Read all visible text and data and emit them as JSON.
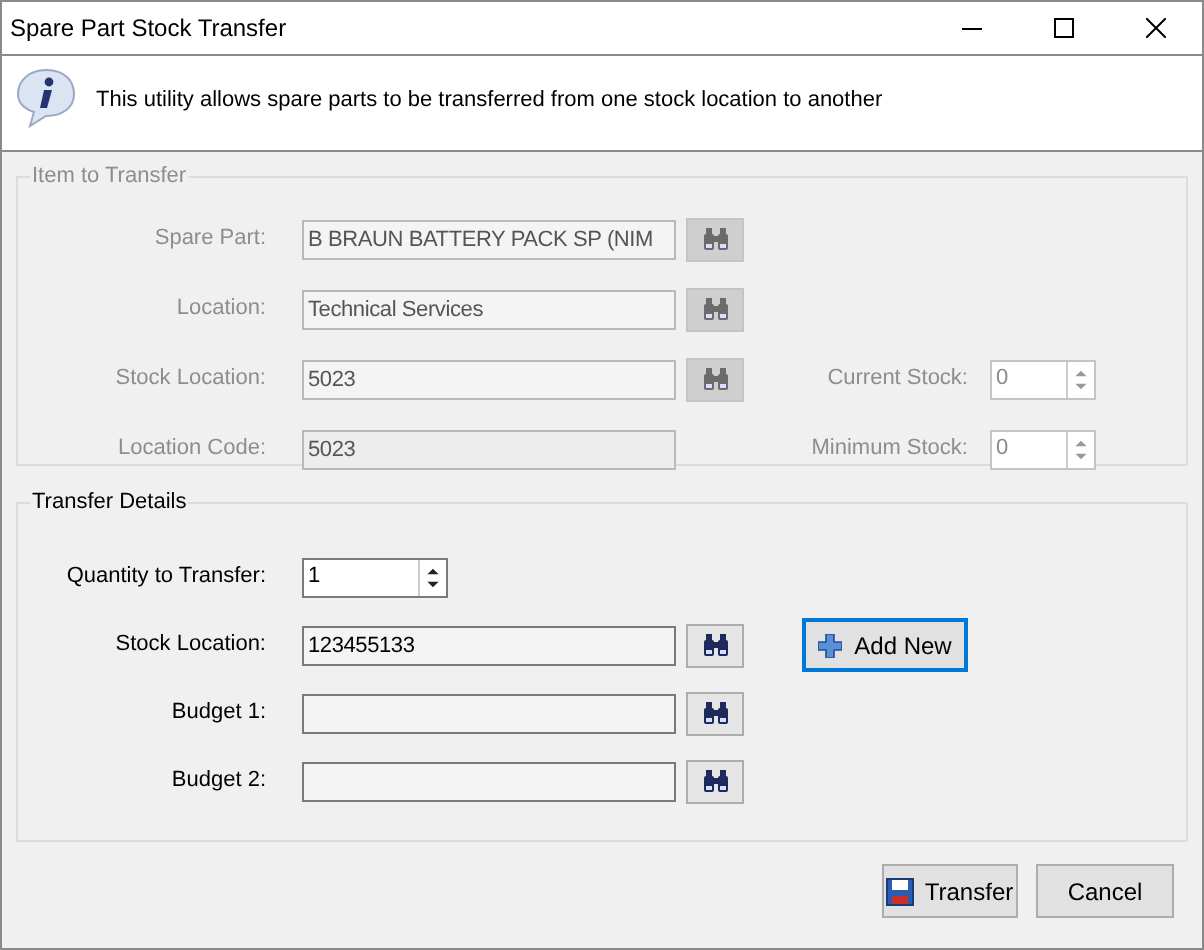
{
  "window": {
    "title": "Spare Part Stock Transfer"
  },
  "info": {
    "text": "This utility allows spare parts to be transferred from one stock location to another"
  },
  "item_group": {
    "title": "Item to Transfer",
    "disabled": true,
    "rows": [
      {
        "label": "Spare Part:",
        "value": "B BRAUN BATTERY PACK SP (NIM",
        "lookup": true
      },
      {
        "label": "Location:",
        "value": "Technical Services",
        "lookup": true
      },
      {
        "label": "Stock Location:",
        "value": "5023",
        "lookup": true,
        "side": {
          "label": "Current Stock:",
          "value": "0"
        }
      },
      {
        "label": "Location Code:",
        "value": "5023",
        "lookup": false,
        "side": {
          "label": "Minimum Stock:",
          "value": "0"
        }
      }
    ]
  },
  "transfer_group": {
    "title": "Transfer Details",
    "disabled": false,
    "rows": [
      {
        "kind": "spinner",
        "label": "Quantity to Transfer:",
        "value": "1"
      },
      {
        "kind": "lookup",
        "label": "Stock Location:",
        "value": "123455133",
        "action": "Add New"
      },
      {
        "kind": "lookup",
        "label": "Budget 1:"
      },
      {
        "kind": "lookup",
        "label": "Budget 2:"
      }
    ]
  },
  "buttons": [
    {
      "label": "Transfer",
      "kind": "save",
      "focused": false
    },
    {
      "label": "Cancel",
      "kind": "plain",
      "focused": false
    }
  ]
}
